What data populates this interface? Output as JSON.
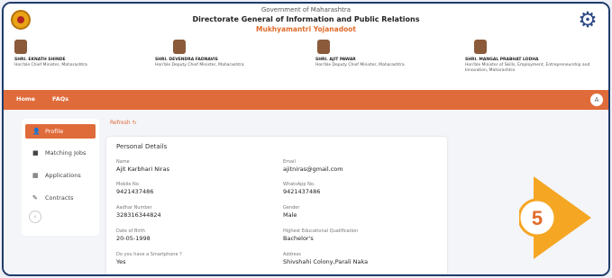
{
  "header": {
    "line1": "Government of Maharashtra",
    "line2": "Directorate General of Information and Public Relations",
    "line3": "Mukhyamantri Yojanadoot",
    "leaders": [
      {
        "name": "SHRI. EKNATH SHINDE",
        "desc": "Hon'ble Chief Minister, Maharashtra"
      },
      {
        "name": "SHRI. DEVENDRA FADNAVIS",
        "desc": "Hon'ble Deputy Chief Minister, Maharashtra"
      },
      {
        "name": "SHRI. AJIT PAWAR",
        "desc": "Hon'ble Deputy Chief Minister, Maharashtra"
      },
      {
        "name": "SHRI. MANGAL PRABHAT LODHA",
        "desc": "Hon'ble Minister of Skills, Employment, Entrepreneurship and Innovation, Maharashtra"
      }
    ]
  },
  "nav": {
    "home": "Home",
    "faqs": "FAQs",
    "avatar": "A"
  },
  "sidebar": {
    "items": [
      {
        "label": "Profile",
        "icon": "person-icon"
      },
      {
        "label": "Matching Jobs",
        "icon": "briefcase-icon"
      },
      {
        "label": "Applications",
        "icon": "grid-icon"
      },
      {
        "label": "Contracts",
        "icon": "pencil-icon"
      }
    ],
    "collapse_icon": "chevron-left-icon"
  },
  "main": {
    "refresh": "Refresh ↻",
    "card_title": "Personal Details",
    "fields": [
      {
        "label": "Name",
        "value": "Ajit Karbhari Niras"
      },
      {
        "label": "Email",
        "value": "ajitniras@gmail.com"
      },
      {
        "label": "Mobile No.",
        "value": "9421437486"
      },
      {
        "label": "WhatsApp No.",
        "value": "9421437486"
      },
      {
        "label": "Aadhar Number",
        "value": "328316344824"
      },
      {
        "label": "Gender",
        "value": "Male"
      },
      {
        "label": "Date of Birth",
        "value": "20-05-1998"
      },
      {
        "label": "Highest Educational Qualification",
        "value": "Bachelor's"
      },
      {
        "label": "Do you have a Smartphone ?",
        "value": "Yes"
      },
      {
        "label": "Address",
        "value": "Shivshahi Colony,Parali Naka"
      }
    ]
  },
  "step_badge": {
    "number": "5",
    "color": "#f5a623"
  },
  "colors": {
    "accent": "#e06b3a",
    "title_accent": "#e06b2a"
  }
}
